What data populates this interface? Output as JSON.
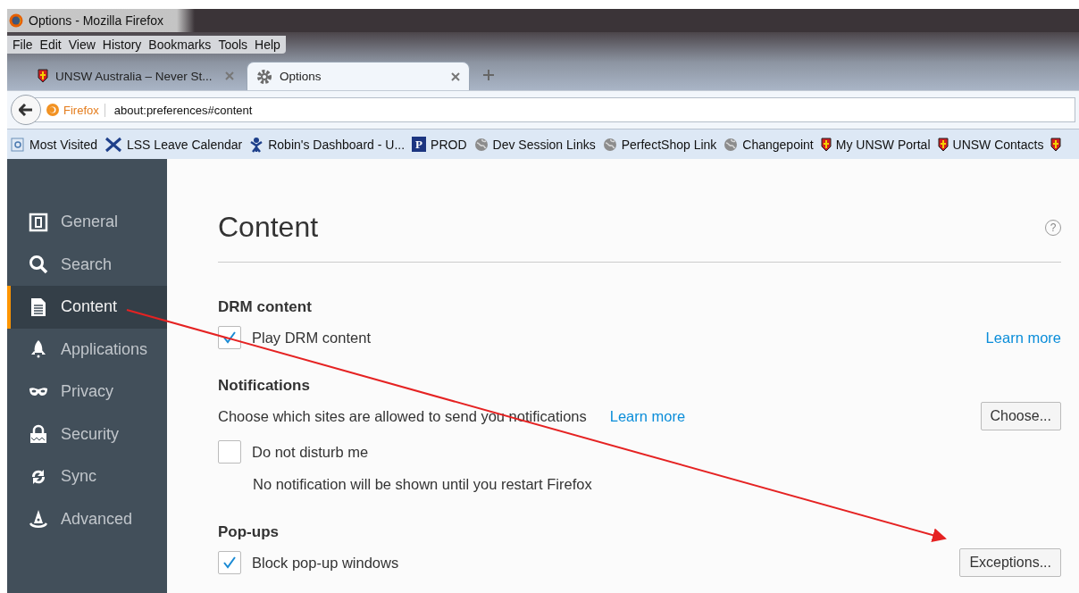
{
  "window": {
    "title": "Options - Mozilla Firefox"
  },
  "menu_bar": [
    "File",
    "Edit",
    "View",
    "History",
    "Bookmarks",
    "Tools",
    "Help"
  ],
  "tabs": [
    {
      "label": "UNSW Australia – Never St...",
      "selected": false,
      "kind": "crest"
    },
    {
      "label": "Options",
      "selected": true,
      "kind": "gear"
    }
  ],
  "address_bar": {
    "identity": "Firefox",
    "url": "about:preferences#content"
  },
  "bookmarks": [
    {
      "label": "Most Visited",
      "kind": "page"
    },
    {
      "label": "LSS Leave Calendar",
      "kind": "tool"
    },
    {
      "label": "Robin's Dashboard - U...",
      "kind": "figure"
    },
    {
      "label": "PROD",
      "kind": "letter",
      "glyph": "P"
    },
    {
      "label": "Dev Session Links",
      "kind": "globe"
    },
    {
      "label": "PerfectShop Link",
      "kind": "globe"
    },
    {
      "label": "Changepoint",
      "kind": "globe"
    },
    {
      "label": "My UNSW Portal",
      "kind": "crest"
    },
    {
      "label": "UNSW Contacts",
      "kind": "crest"
    },
    {
      "kind": "crest"
    }
  ],
  "sidebar": {
    "items": [
      {
        "label": "General",
        "selected": false
      },
      {
        "label": "Search",
        "selected": false
      },
      {
        "label": "Content",
        "selected": true
      },
      {
        "label": "Applications",
        "selected": false
      },
      {
        "label": "Privacy",
        "selected": false
      },
      {
        "label": "Security",
        "selected": false
      },
      {
        "label": "Sync",
        "selected": false
      },
      {
        "label": "Advanced",
        "selected": false
      }
    ]
  },
  "page": {
    "heading": "Content",
    "help": "?",
    "sections": [
      {
        "title": "DRM content",
        "rows": [
          {
            "kind": "checkbox",
            "label": "Play DRM content",
            "checked": true,
            "link": "Learn more"
          }
        ]
      },
      {
        "title": "Notifications",
        "rows": [
          {
            "kind": "text",
            "label": "Choose which sites are allowed to send you notifications",
            "link": "Learn more",
            "button": "Choose..."
          },
          {
            "kind": "checkbox",
            "label": "Do not disturb me",
            "checked": false
          },
          {
            "kind": "note",
            "label": "No notification will be shown until you restart Firefox"
          }
        ]
      },
      {
        "title": "Pop-ups",
        "rows": [
          {
            "kind": "checkbox",
            "label": "Block pop-up windows",
            "checked": true,
            "button": "Exceptions..."
          }
        ]
      }
    ]
  }
}
